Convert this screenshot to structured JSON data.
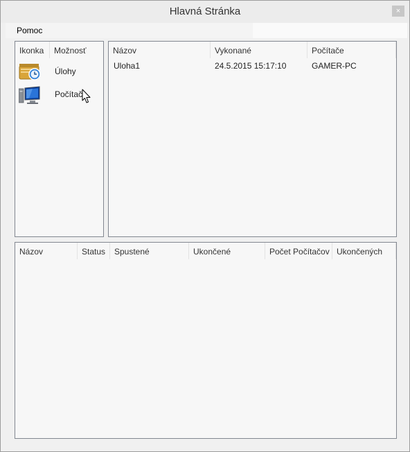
{
  "window": {
    "title": "Hlavná Stránka",
    "close_glyph": "×"
  },
  "menu": {
    "items": [
      "Pomoc"
    ]
  },
  "options_panel": {
    "columns": [
      "Ikonka",
      "Možnosť"
    ],
    "items": [
      {
        "icon": "calendar-clock-icon",
        "label": "Úlohy"
      },
      {
        "icon": "computer-monitor-icon",
        "label": "Počítače"
      }
    ]
  },
  "tasks_table": {
    "columns": [
      "Názov",
      "Vykonané",
      "Počítače"
    ],
    "rows": [
      [
        "Uloha1",
        "24.5.2015 15:17:10",
        "GAMER-PC"
      ]
    ]
  },
  "runs_table": {
    "columns": [
      "Názov",
      "Status",
      "Spustené",
      "Ukončené",
      "Počet Počítačov",
      "Ukončených"
    ],
    "rows": []
  }
}
